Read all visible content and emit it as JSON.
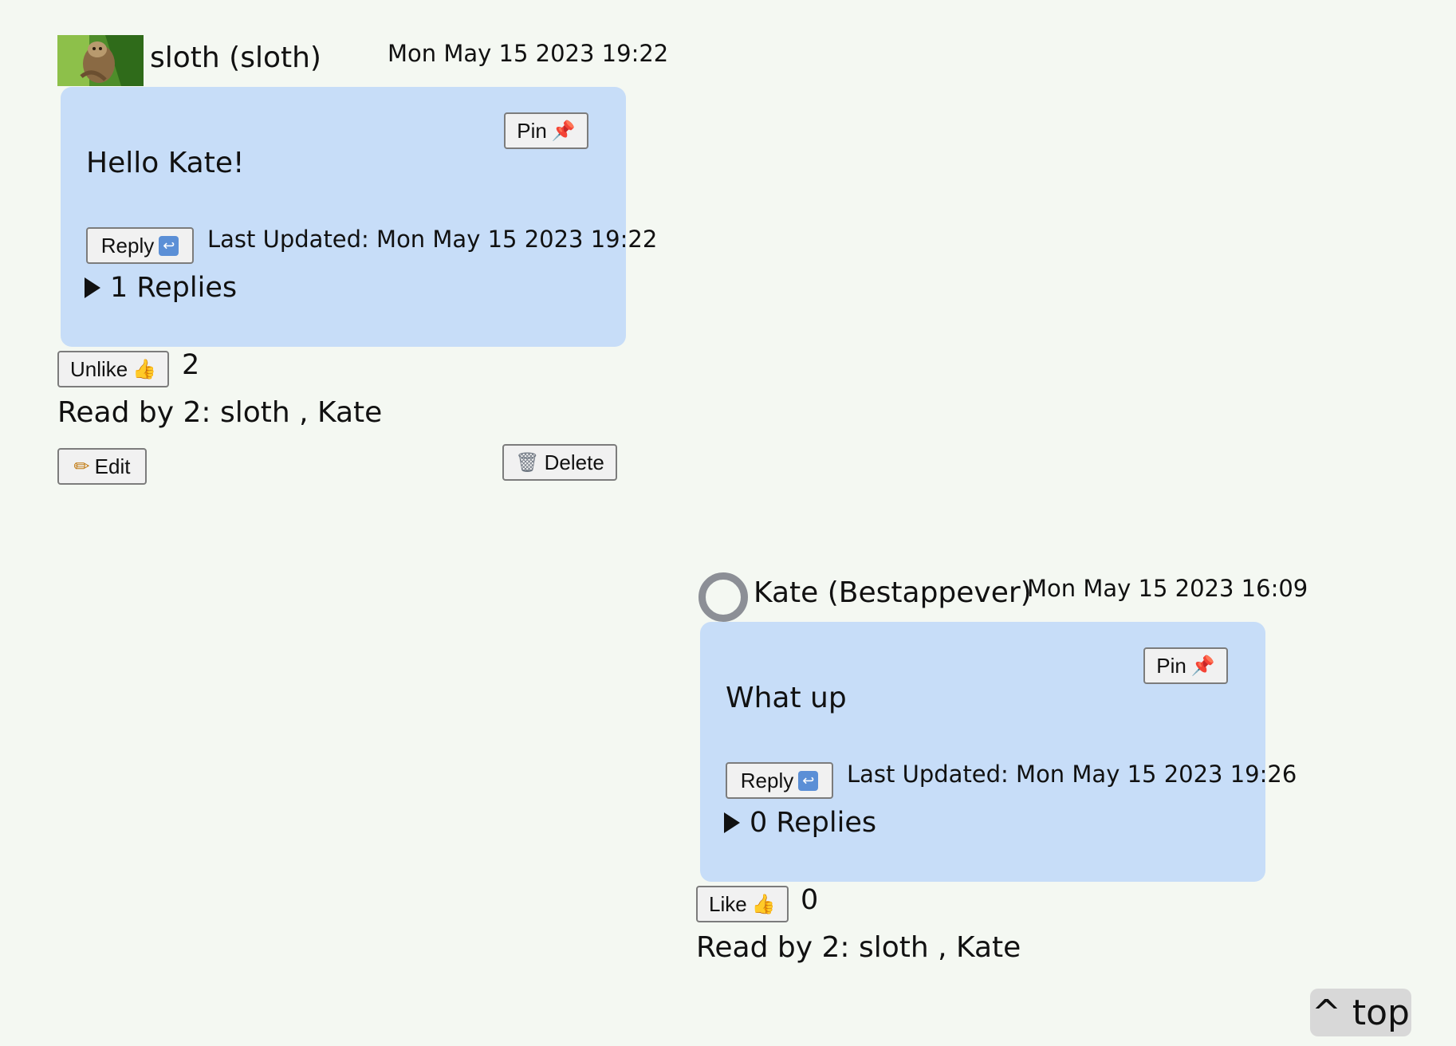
{
  "messages": [
    {
      "author": "sloth (sloth)",
      "timestamp": "Mon May 15 2023 19:22",
      "pin_label": "Pin",
      "pin_icon": "📌",
      "text": "Hello Kate!",
      "reply_label": "Reply",
      "reply_icon": "↩",
      "last_updated": "Last Updated: Mon May 15 2023 19:22",
      "replies": "1 Replies",
      "like_label": "Unlike",
      "like_icon": "👍",
      "like_count": "2",
      "read_by": "Read by 2: sloth , Kate",
      "edit_label": "Edit",
      "edit_icon": "✏",
      "delete_label": "Delete",
      "delete_icon": "🗑"
    },
    {
      "author": "Kate (Bestappever)",
      "timestamp": "Mon May 15 2023 16:09",
      "pin_label": "Pin",
      "pin_icon": "📌",
      "text": "What up",
      "reply_label": "Reply",
      "reply_icon": "↩",
      "last_updated": "Last Updated: Mon May 15 2023 19:26",
      "replies": "0 Replies",
      "like_label": "Like",
      "like_icon": "👍",
      "like_count": "0",
      "read_by": "Read by 2: sloth , Kate"
    }
  ],
  "top_button_label": "^ top"
}
